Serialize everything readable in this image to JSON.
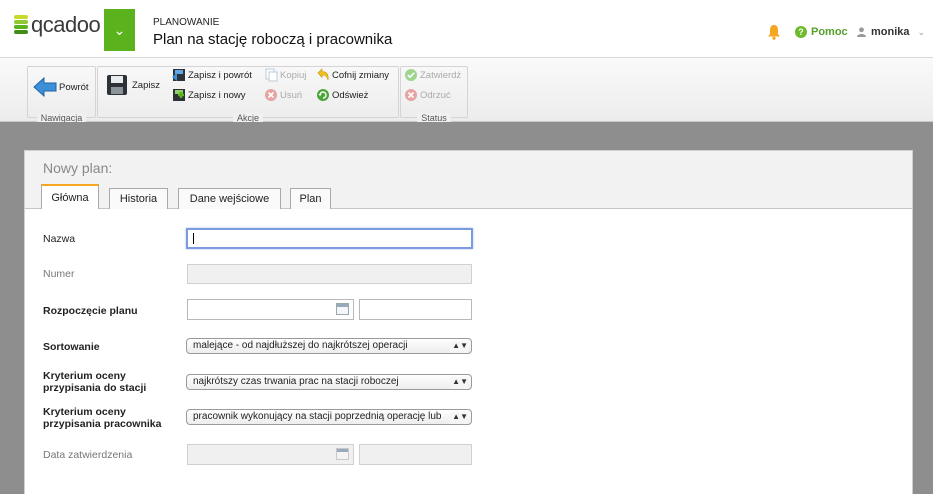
{
  "header": {
    "logo_text": "qcadoo",
    "breadcrumb": "PLANOWANIE",
    "title": "Plan na stację roboczą i pracownika",
    "help_label": "Pomoc",
    "user_name": "monika"
  },
  "toolbar": {
    "back_label": "Powrót",
    "save_label": "Zapisz",
    "save_back_label": "Zapisz i powrót",
    "save_new_label": "Zapisz i nowy",
    "copy_label": "Kopiuj",
    "delete_label": "Usuń",
    "undo_label": "Cofnij zmiany",
    "refresh_label": "Odśwież",
    "approve_label": "Zatwierdź",
    "reject_label": "Odrzuć",
    "group_navigation": "Nawigacja",
    "group_actions": "Akcje",
    "group_status": "Status"
  },
  "panel": {
    "title": "Nowy plan:",
    "tabs": [
      "Główna",
      "Historia",
      "Dane wejściowe",
      "Plan"
    ]
  },
  "form": {
    "name_label": "Nazwa",
    "name_value": "",
    "number_label": "Numer",
    "number_value": "",
    "start_label": "Rozpoczęcie planu",
    "sort_label": "Sortowanie",
    "sort_value": "malejące - od najdłuższej do najkrótszej operacji",
    "station_criterion_label_1": "Kryterium oceny",
    "station_criterion_label_2": "przypisania do stacji",
    "station_criterion_value": "najkrótszy czas trwania prac na stacji roboczej",
    "worker_criterion_label_1": "Kryterium oceny",
    "worker_criterion_label_2": "przypisania pracownika",
    "worker_criterion_value": "pracownik wykonujący na stacji poprzednią operację lub",
    "approval_date_label": "Data zatwierdzenia"
  },
  "colors": {
    "brand_green": "#5ab21d",
    "tab_accent": "#f5a623",
    "focus_border": "#7b9be0"
  }
}
